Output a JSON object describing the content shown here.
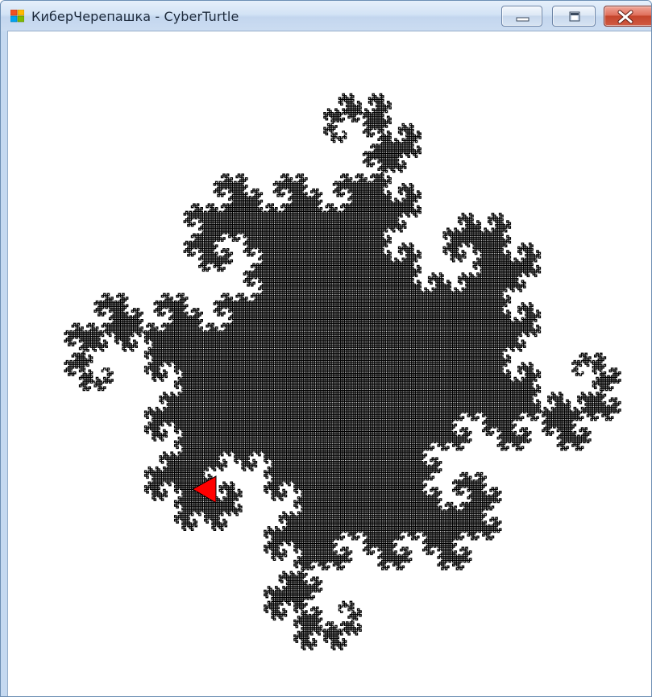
{
  "window": {
    "title": "КиберЧерепашка - CyberTurtle",
    "icon": "windows-app-icon",
    "controls": {
      "minimize": "minimize-icon",
      "maximize": "maximize-icon",
      "close": "close-icon"
    }
  },
  "drawing": {
    "figure": "dragon-curve",
    "stroke_color": "#000000",
    "turtle": {
      "icon": "turtle-triangle-icon",
      "color": "#ff0000",
      "heading": "left"
    }
  }
}
